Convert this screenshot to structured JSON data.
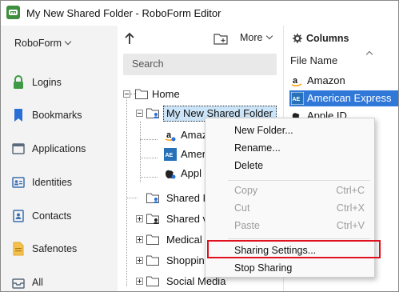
{
  "window": {
    "title": "My New Shared Folder - RoboForm Editor"
  },
  "sidebar": {
    "menu_label": "RoboForm",
    "items": [
      {
        "label": "Logins",
        "icon": "lock-icon",
        "color": "#3f9a45"
      },
      {
        "label": "Bookmarks",
        "icon": "bookmark-icon",
        "color": "#2a6fd6"
      },
      {
        "label": "Applications",
        "icon": "application-window-icon",
        "color": "#5a6a7a"
      },
      {
        "label": "Identities",
        "icon": "id-card-icon",
        "color": "#3b6fb0"
      },
      {
        "label": "Contacts",
        "icon": "contact-card-icon",
        "color": "#3b6fb0"
      },
      {
        "label": "Safenotes",
        "icon": "note-icon",
        "color": "#e6a72a"
      },
      {
        "label": "All",
        "icon": "inbox-tray-icon",
        "color": "#5a6a7a"
      }
    ]
  },
  "toolbar": {
    "more_label": "More",
    "search_placeholder": "Search"
  },
  "tree": {
    "home": "Home",
    "selected_folder": "My New Shared Folder",
    "children": [
      "Amazon",
      "American Express",
      "Apple ID"
    ],
    "children_visible": [
      "Amaz",
      "Amer",
      "Appl"
    ],
    "siblings": [
      "Shared I",
      "Shared v",
      "Medical",
      "Shoppin",
      "Social Media"
    ]
  },
  "right_pane": {
    "columns_label": "Columns",
    "header": "File Name",
    "files": [
      "Amazon",
      "American Express",
      "Apple ID"
    ]
  },
  "context_menu": {
    "items": [
      {
        "label": "New Folder...",
        "shortcut": "",
        "enabled": true
      },
      {
        "label": "Rename...",
        "shortcut": "",
        "enabled": true
      },
      {
        "label": "Delete",
        "shortcut": "",
        "enabled": true
      },
      {
        "label": "Copy",
        "shortcut": "Ctrl+C",
        "enabled": false
      },
      {
        "label": "Cut",
        "shortcut": "Ctrl+X",
        "enabled": false
      },
      {
        "label": "Paste",
        "shortcut": "Ctrl+V",
        "enabled": false
      },
      {
        "label": "Sharing Settings...",
        "shortcut": "",
        "enabled": true,
        "highlighted": true
      },
      {
        "label": "Stop Sharing",
        "shortcut": "",
        "enabled": true
      }
    ]
  },
  "colors": {
    "highlight_border": "#e0101f",
    "selection": "#cce4f7",
    "file_selected": "#3078d8",
    "brand": "#3f8f3f"
  }
}
